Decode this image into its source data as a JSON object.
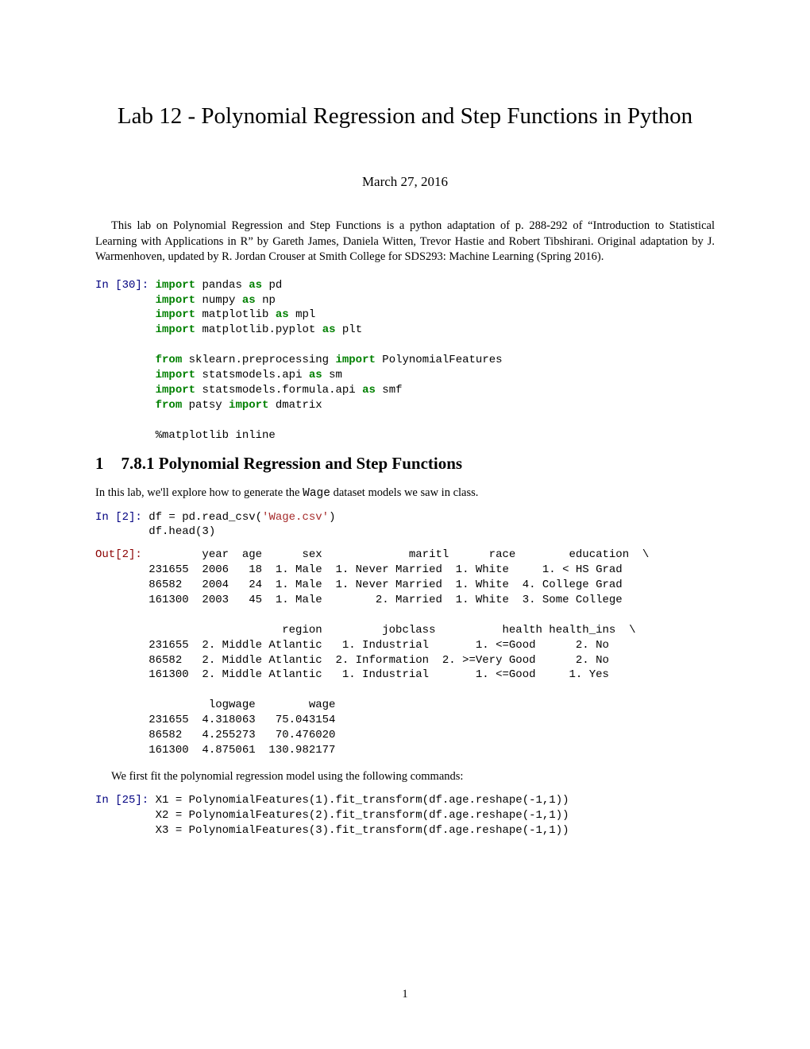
{
  "title": "Lab 12 - Polynomial Regression and Step Functions in Python",
  "date": "March 27, 2016",
  "intro": "This lab on Polynomial Regression and Step Functions is a python adaptation of p. 288-292 of “Introduction to Statistical Learning with Applications in R” by Gareth James, Daniela Witten, Trevor Hastie and Robert Tibshirani. Original adaptation by J. Warmenhoven, updated by R. Jordan Crouser at Smith College for SDS293: Machine Learning (Spring 2016).",
  "code1": {
    "prompt": "In [30]:",
    "lines": [
      [
        [
          "green",
          "import"
        ],
        [
          "",
          " pandas "
        ],
        [
          "green",
          "as"
        ],
        [
          "",
          " pd"
        ]
      ],
      [
        [
          "green",
          "import"
        ],
        [
          "",
          " numpy "
        ],
        [
          "green",
          "as"
        ],
        [
          "",
          " np"
        ]
      ],
      [
        [
          "green",
          "import"
        ],
        [
          "",
          " matplotlib "
        ],
        [
          "green",
          "as"
        ],
        [
          "",
          " mpl"
        ]
      ],
      [
        [
          "green",
          "import"
        ],
        [
          "",
          " matplotlib.pyplot "
        ],
        [
          "green",
          "as"
        ],
        [
          "",
          " plt"
        ]
      ],
      [
        [
          "",
          ""
        ]
      ],
      [
        [
          "green",
          "from"
        ],
        [
          "",
          " sklearn.preprocessing "
        ],
        [
          "green",
          "import"
        ],
        [
          "",
          " PolynomialFeatures"
        ]
      ],
      [
        [
          "green",
          "import"
        ],
        [
          "",
          " statsmodels.api "
        ],
        [
          "green",
          "as"
        ],
        [
          "",
          " sm"
        ]
      ],
      [
        [
          "green",
          "import"
        ],
        [
          "",
          " statsmodels.formula.api "
        ],
        [
          "green",
          "as"
        ],
        [
          "",
          " smf"
        ]
      ],
      [
        [
          "green",
          "from"
        ],
        [
          "",
          " patsy "
        ],
        [
          "green",
          "import"
        ],
        [
          "",
          " dmatrix"
        ]
      ],
      [
        [
          "",
          ""
        ]
      ],
      [
        [
          "",
          "%matplotlib inline"
        ]
      ]
    ]
  },
  "section": {
    "num": "1",
    "title": "7.8.1 Polynomial Regression and Step Functions"
  },
  "body1_pre": "In this lab, we'll explore how to generate the ",
  "body1_tt": "Wage",
  "body1_post": " dataset models we saw in class.",
  "code2": {
    "prompt": "In [2]:",
    "lines": [
      [
        [
          "",
          "df = pd.read_csv("
        ],
        [
          "brown",
          "'Wage.csv'"
        ],
        [
          "",
          ")"
        ]
      ],
      [
        [
          "",
          "df.head(3)"
        ]
      ]
    ]
  },
  "out2": {
    "prompt": "Out[2]:",
    "text": "        year  age      sex             maritl      race        education  \\\n231655  2006   18  1. Male  1. Never Married  1. White     1. < HS Grad\n86582   2004   24  1. Male  1. Never Married  1. White  4. College Grad\n161300  2003   45  1. Male        2. Married  1. White  3. Some College\n\n                    region         jobclass          health health_ins  \\\n231655  2. Middle Atlantic   1. Industrial       1. <=Good      2. No\n86582   2. Middle Atlantic  2. Information  2. >=Very Good      2. No\n161300  2. Middle Atlantic   1. Industrial       1. <=Good     1. Yes\n\n         logwage        wage\n231655  4.318063   75.043154\n86582   4.255273   70.476020\n161300  4.875061  130.982177"
  },
  "body2": "We first fit the polynomial regression model using the following commands:",
  "code3": {
    "prompt": "In [25]:",
    "lines": [
      [
        [
          "",
          "X1 = PolynomialFeatures(1).fit_transform(df.age.reshape(-1,1))"
        ]
      ],
      [
        [
          "",
          "X2 = PolynomialFeatures(2).fit_transform(df.age.reshape(-1,1))"
        ]
      ],
      [
        [
          "",
          "X3 = PolynomialFeatures(3).fit_transform(df.age.reshape(-1,1))"
        ]
      ]
    ]
  },
  "pagenum": "1"
}
